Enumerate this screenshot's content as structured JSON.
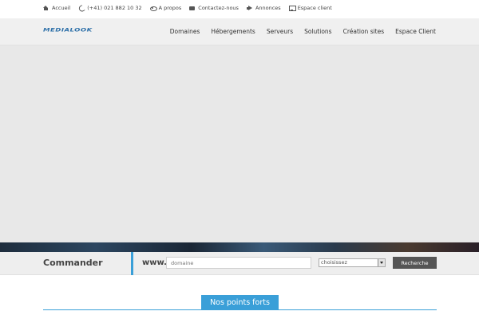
{
  "topbar": {
    "links": [
      {
        "icon": "home-icon",
        "label": "Accueil"
      },
      {
        "icon": "phone-icon",
        "label": "(+41) 021 882 10 32"
      },
      {
        "icon": "eye-icon",
        "label": "A propos"
      },
      {
        "icon": "mail-icon",
        "label": "Contactez-nous"
      },
      {
        "icon": "megaphone-icon",
        "label": "Annonces"
      },
      {
        "icon": "monitor-icon",
        "label": "Espace client"
      }
    ]
  },
  "header": {
    "logo": "Medialook",
    "nav": [
      "Domaines",
      "Hébergements",
      "Serveurs",
      "Solutions",
      "Création sites",
      "Espace Client"
    ]
  },
  "order": {
    "title": "Commander",
    "prefix": "www.",
    "domain_placeholder": "domaine",
    "extension_selected": "choisissez",
    "search_label": "Recherche"
  },
  "section": {
    "title": "Nos points forts"
  },
  "colors": {
    "accent": "#3a9fd8",
    "logo": "#2c6fa8",
    "button": "#555555"
  }
}
